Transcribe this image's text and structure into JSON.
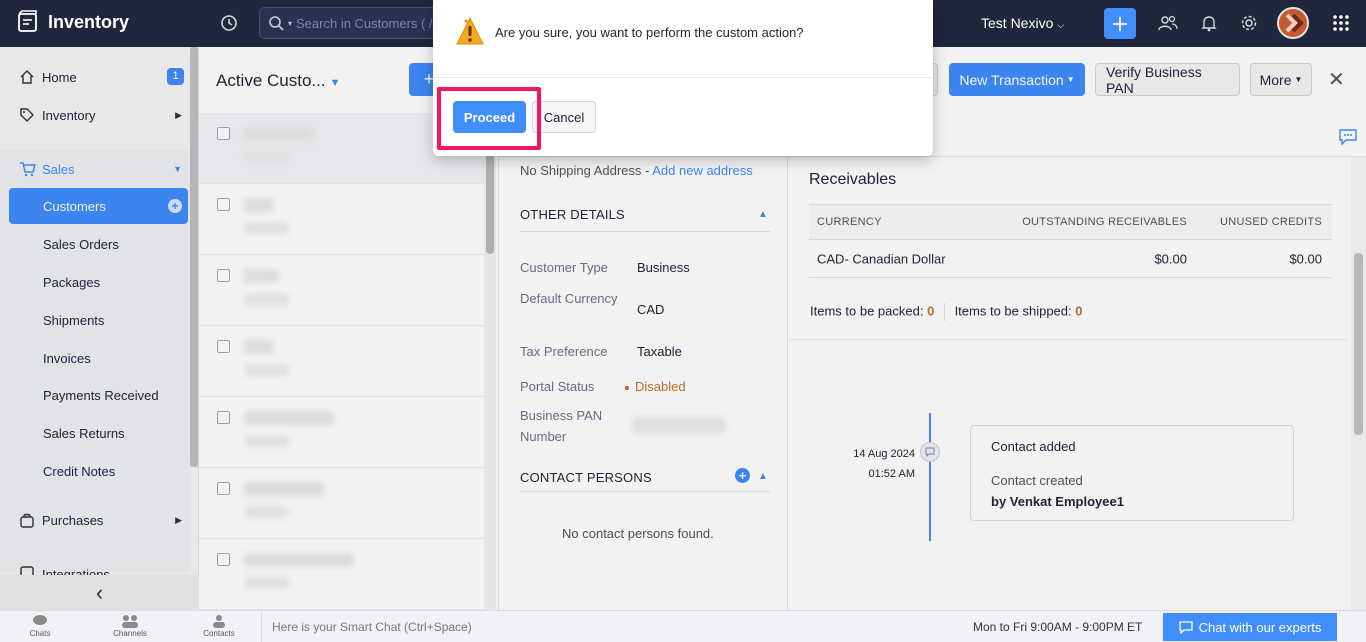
{
  "app": {
    "name": "Inventory",
    "org_name": "Test Nexivo"
  },
  "search": {
    "placeholder": "Search in Customers ( / )"
  },
  "sidebar": {
    "home": {
      "label": "Home",
      "badge": "1"
    },
    "inventory": {
      "label": "Inventory"
    },
    "sales": {
      "label": "Sales",
      "items": [
        {
          "label": "Customers"
        },
        {
          "label": "Sales Orders"
        },
        {
          "label": "Packages"
        },
        {
          "label": "Shipments"
        },
        {
          "label": "Invoices"
        },
        {
          "label": "Payments Received"
        },
        {
          "label": "Sales Returns"
        },
        {
          "label": "Credit Notes"
        }
      ]
    },
    "purchases": {
      "label": "Purchases"
    },
    "integrations": {
      "label": "Integrations"
    },
    "collapse_glyph": "‹"
  },
  "list": {
    "title": "Active Custo...",
    "new_glyph": "+"
  },
  "detail": {
    "buttons": {
      "new_transaction": "New Transaction",
      "verify_pan": "Verify Business PAN",
      "more": "More"
    },
    "close_glyph": "✕",
    "shipping": {
      "text": "No Shipping Address - ",
      "link": "Add new address"
    },
    "other_details": {
      "heading": "OTHER DETAILS",
      "rows": [
        {
          "label": "Customer Type",
          "value": "Business"
        },
        {
          "label": "Default Currency",
          "value": "CAD"
        },
        {
          "label": "Tax Preference",
          "value": "Taxable"
        },
        {
          "label": "Portal Status",
          "value": "Disabled"
        },
        {
          "label": "Business PAN Number",
          "value": ""
        }
      ]
    },
    "contact_persons": {
      "heading": "CONTACT PERSONS",
      "empty": "No contact persons found."
    },
    "receivables": {
      "title": "Receivables",
      "headers": [
        "CURRENCY",
        "OUTSTANDING RECEIVABLES",
        "UNUSED CREDITS"
      ],
      "rows": [
        {
          "currency": "CAD- Canadian Dollar",
          "outstanding": "$0.00",
          "unused": "$0.00"
        }
      ]
    },
    "items": {
      "packed_label": "Items to be packed:",
      "packed_value": "0",
      "shipped_label": "Items to be shipped:",
      "shipped_value": "0"
    },
    "timeline": {
      "date": "14 Aug 2024",
      "time": "01:52 AM",
      "title": "Contact added",
      "desc": "Contact created",
      "by": "by Venkat Employee1"
    }
  },
  "dialog": {
    "message": "Are you sure, you want to perform the custom action?",
    "proceed": "Proceed",
    "cancel": "Cancel"
  },
  "bottombar": {
    "chats": "Chats",
    "channels": "Channels",
    "contacts": "Contacts",
    "smart_chat": "Here is your Smart Chat (Ctrl+Space)",
    "hours": "Mon to Fri 9:00AM - 9:00PM ET",
    "experts": "Chat with our experts"
  },
  "colors": {
    "topbar": "#21263c",
    "accent": "#408dfb",
    "highlight": "#f0185a",
    "warning": "#f5a623"
  }
}
